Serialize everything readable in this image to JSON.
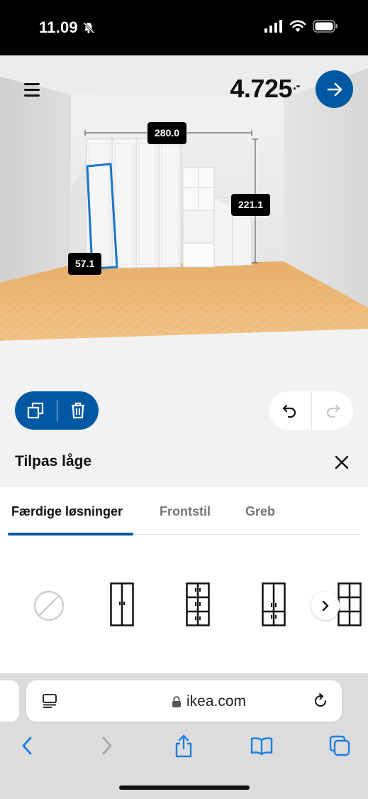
{
  "status": {
    "time": "11.09",
    "icons": [
      "bell-muted-icon",
      "cellular-signal-icon",
      "wifi-icon",
      "battery-icon"
    ]
  },
  "header": {
    "price": "4.725",
    "price_suffix": ".-",
    "icons": [
      "menu-icon",
      "arrow-left-icon",
      "arrow-right-icon"
    ]
  },
  "dimensions": {
    "width": "280.0",
    "height": "221.1",
    "depth": "57.1"
  },
  "actions": {
    "icons": [
      "duplicate-icon",
      "trash-icon",
      "undo-icon",
      "redo-icon"
    ]
  },
  "panel": {
    "title": "Tilpas låge"
  },
  "tabs": [
    {
      "label": "Færdige løsninger",
      "active": true
    },
    {
      "label": "Frontstil",
      "active": false
    },
    {
      "label": "Greb",
      "active": false
    }
  ],
  "options": [
    "no-door-option",
    "two-door-option",
    "six-door-option",
    "four-door-option",
    "partial-option"
  ],
  "browser": {
    "url": "ikea.com"
  },
  "colors": {
    "accent": "#0058a3",
    "floor": "#eebc7a",
    "wall": "#e9e9e9"
  }
}
